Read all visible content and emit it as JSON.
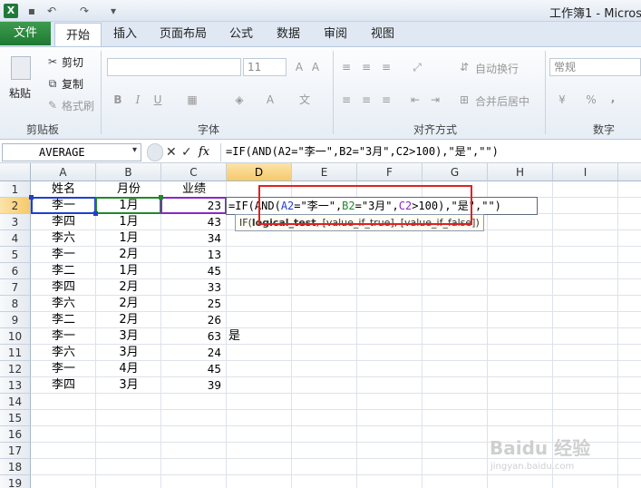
{
  "window": {
    "title": "工作簿1 - Micros"
  },
  "tabs": {
    "file": "文件",
    "items": [
      "开始",
      "插入",
      "页面布局",
      "公式",
      "数据",
      "审阅",
      "视图"
    ]
  },
  "ribbon": {
    "clipboard": {
      "paste": "粘贴",
      "cut": "剪切",
      "copy": "复制",
      "format_painter": "格式刷",
      "label": "剪贴板"
    },
    "font": {
      "size": "11",
      "label": "字体",
      "bold": "B",
      "italic": "I",
      "underline": "U"
    },
    "alignment": {
      "wrap": "自动换行",
      "merge": "合并后居中",
      "label": "对齐方式"
    },
    "number": {
      "format": "常规",
      "percent": "%",
      "comma": ",",
      "label": "数字"
    }
  },
  "formula_bar": {
    "name_box": "AVERAGE",
    "fx": "fx",
    "formula": "=IF(AND(A2=\"李一\",B2=\"3月\",C2>100),\"是\",\"\")"
  },
  "columns": [
    "A",
    "B",
    "C",
    "D",
    "E",
    "F",
    "G",
    "H",
    "I"
  ],
  "rows": [
    "1",
    "2",
    "3",
    "4",
    "5",
    "6",
    "7",
    "8",
    "9",
    "10",
    "11",
    "12",
    "13",
    "14",
    "15",
    "16",
    "17",
    "18",
    "19"
  ],
  "table": {
    "headers": [
      "姓名",
      "月份",
      "业绩"
    ],
    "data": [
      [
        "李一",
        "1月",
        "23"
      ],
      [
        "李四",
        "1月",
        "43"
      ],
      [
        "李六",
        "1月",
        "34"
      ],
      [
        "李一",
        "2月",
        "13"
      ],
      [
        "李二",
        "1月",
        "45"
      ],
      [
        "李四",
        "2月",
        "33"
      ],
      [
        "李六",
        "2月",
        "25"
      ],
      [
        "李二",
        "2月",
        "26"
      ],
      [
        "李一",
        "3月",
        "63"
      ],
      [
        "李六",
        "3月",
        "24"
      ],
      [
        "李一",
        "4月",
        "45"
      ],
      [
        "李四",
        "3月",
        "39"
      ]
    ]
  },
  "editing_cell": {
    "part_if": "=IF(",
    "part_and": "AND(",
    "part_a2": "A2",
    "part_eq1": "=\"李一\",",
    "part_b2": "B2",
    "part_eq2": "=\"3月\",",
    "part_c2": "C2",
    "part_gt": ">100)",
    "part_rest": ",\"是\",\"\")"
  },
  "d10_value": "是",
  "tooltip": {
    "fn": "IF(",
    "arg1": "logical_test",
    "rest": ", [value_if_true], [value_if_false])"
  },
  "watermark": {
    "line1": "Baidu 经验",
    "line2": "jingyan.baidu.com"
  },
  "colors": {
    "accent_green": "#1e7a32",
    "ref_blue": "#1f3fd1",
    "ref_green": "#1f8a2a",
    "ref_purple": "#8b27c9",
    "highlight_red": "#e32020"
  }
}
